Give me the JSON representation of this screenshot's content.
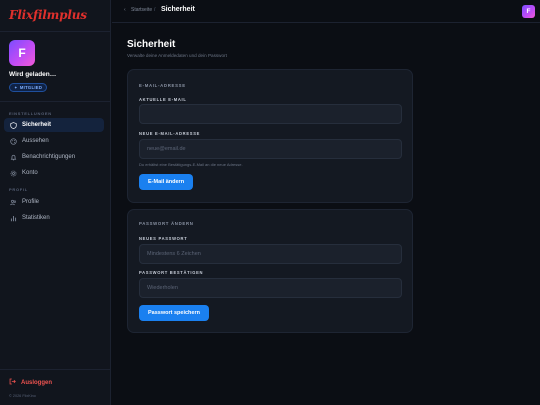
{
  "app": {
    "logo": "Flixfilmplus",
    "copyright": "© 2026 FlixKino"
  },
  "user": {
    "initial": "F",
    "name": "Wird geladen…",
    "badge": "MITGLIED"
  },
  "sidebar": {
    "settings_label": "EINSTELLUNGEN",
    "profile_label": "PROFIL",
    "items": [
      {
        "label": "Sicherheit",
        "icon": "shield-icon",
        "active": true
      },
      {
        "label": "Aussehen",
        "icon": "palette-icon",
        "active": false
      },
      {
        "label": "Benachrichtigungen",
        "icon": "bell-icon",
        "active": false
      },
      {
        "label": "Konto",
        "icon": "gear-icon",
        "active": false
      },
      {
        "label": "Profile",
        "icon": "users-icon",
        "active": false
      },
      {
        "label": "Statistiken",
        "icon": "bar-chart-icon",
        "active": false
      }
    ],
    "logout": "Ausloggen"
  },
  "topbar": {
    "back": "‹",
    "home": "Startseite",
    "separator": "/",
    "current": "Sicherheit"
  },
  "main": {
    "title": "Sicherheit",
    "subtitle": "Verwalte deine Anmeldedaten und dein Passwort"
  },
  "email_card": {
    "title": "E-MAIL-ADRESSE",
    "current_label": "AKTUELLE E-MAIL",
    "current_value": "",
    "new_label": "NEUE E-MAIL-ADRESSE",
    "new_placeholder": "neue@email.de",
    "hint": "Du erhältst eine Bestätigungs-E-Mail an die neue Adresse.",
    "button": "E-Mail ändern"
  },
  "password_card": {
    "title": "PASSWORT ÄNDERN",
    "new_label": "NEUES PASSWORT",
    "new_placeholder": "Mindestens 6 Zeichen",
    "confirm_label": "PASSWORT BESTÄTIGEN",
    "confirm_placeholder": "Wiederholen",
    "button": "Passwort speichern"
  },
  "colors": {
    "accent": "#1a80f0",
    "logo": "#e0302c",
    "logout": "#ef5350",
    "avatar_gradient": [
      "#7b4dff",
      "#f25ad6"
    ]
  }
}
